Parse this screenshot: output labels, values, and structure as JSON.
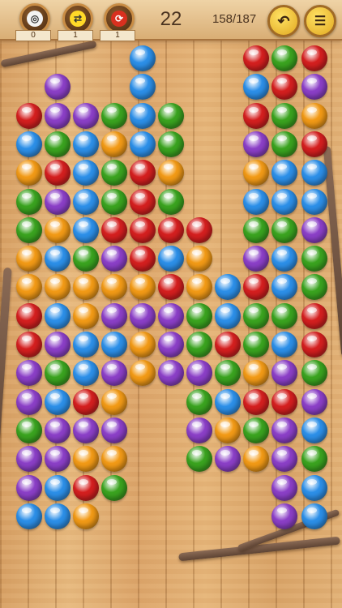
{
  "toolbar": {
    "tools": [
      {
        "name": "pin",
        "icon": "pushpin-icon",
        "count": "0"
      },
      {
        "name": "swap",
        "icon": "swap-arrows-icon",
        "count": "1"
      },
      {
        "name": "shuffle",
        "icon": "shuffle-icon",
        "count": "1"
      }
    ],
    "level": "22",
    "progress": "158/187",
    "undo_icon": "undo-icon",
    "menu_icon": "menu-icon"
  },
  "colors": {
    "blue": "#2c8fe8",
    "purple": "#8b3fc7",
    "red": "#d41f1f",
    "orange": "#f29a16",
    "green": "#3aa31f"
  },
  "board": {
    "columns": 11,
    "rows": 17,
    "cells": [
      "____b___rgr",
      "_p__b___brp",
      "rppgbg__rgo",
      "bgbobg__pgr",
      "orbgro__obb",
      "gpbgrg__bbb",
      "gobrrrr_ggp",
      "obgprbo_pbg",
      "ooooorobrbg",
      "rbopppgbggr",
      "rpbbopgrgbr",
      "pgbpoppgopg",
      "pbro__gbrrp",
      "gppp__pogpb",
      "ppoo__gpopg",
      "pbrg_____pb",
      "bbo______pb"
    ]
  }
}
